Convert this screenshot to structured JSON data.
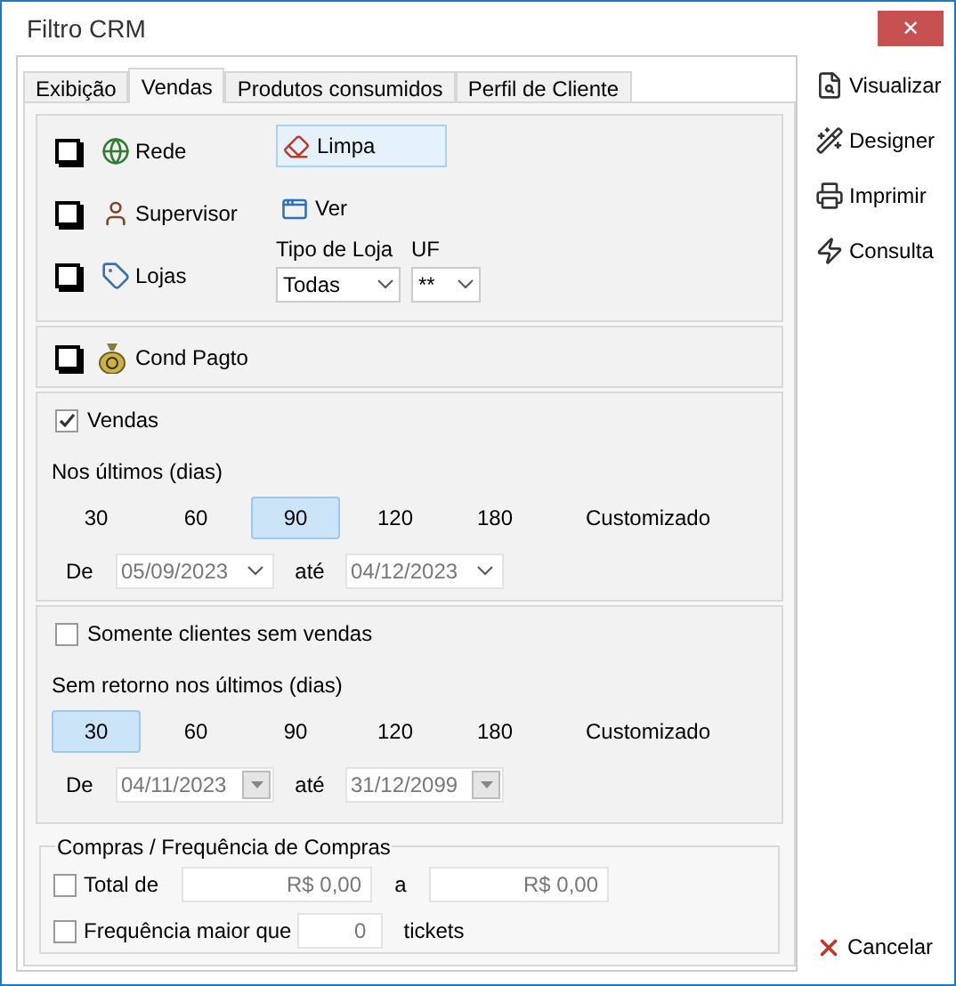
{
  "window": {
    "title": "Filtro CRM",
    "close": "✕"
  },
  "tabs": [
    {
      "label": "Exibição",
      "selected": false
    },
    {
      "label": "Vendas",
      "selected": true
    },
    {
      "label": "Produtos consumidos",
      "selected": false
    },
    {
      "label": "Perfil de Cliente",
      "selected": false
    }
  ],
  "filters": [
    {
      "label": "Rede",
      "checked": false
    },
    {
      "label": "Supervisor",
      "checked": false
    },
    {
      "label": "Lojas",
      "checked": false
    }
  ],
  "limpa_button": {
    "label": "Limpa"
  },
  "ver_button": {
    "label": "Ver"
  },
  "tipo_de_loja": {
    "label": "Tipo de Loja",
    "value": "Todas"
  },
  "uf": {
    "label": "UF",
    "value": "**"
  },
  "cond_pagto": {
    "label": "Cond Pagto",
    "checked": false
  },
  "sales_sections": [
    {
      "label": "Vendas",
      "checked": true,
      "subtitle": "Nos últimos (dias)",
      "periods": [
        {
          "label": "30",
          "selected": false
        },
        {
          "label": "60",
          "selected": false
        },
        {
          "label": "90",
          "selected": true
        },
        {
          "label": "120",
          "selected": false
        },
        {
          "label": "180",
          "selected": false
        },
        {
          "label": "Customizado",
          "selected": false
        }
      ],
      "de_label": "De",
      "de_value": "05/09/2023",
      "ate_label": "até",
      "ate_value": "04/12/2023",
      "kind": "chevron"
    },
    {
      "label": "Somente clientes sem vendas",
      "checked": false,
      "subtitle": "Sem retorno nos últimos (dias)",
      "periods": [
        {
          "label": "30",
          "selected": true
        },
        {
          "label": "60",
          "selected": false
        },
        {
          "label": "90",
          "selected": false
        },
        {
          "label": "120",
          "selected": false
        },
        {
          "label": "180",
          "selected": false
        },
        {
          "label": "Customizado",
          "selected": false
        }
      ],
      "de_label": "De",
      "de_value": "04/11/2023",
      "ate_label": "até",
      "ate_value": "31/12/2099",
      "kind": "button"
    }
  ],
  "compras": {
    "title": "Compras / Frequência de Compras",
    "total": {
      "label": "Total de",
      "checked": false,
      "from": "R$ 0,00",
      "to_label": "a",
      "to": "R$ 0,00"
    },
    "frequencia": {
      "label": "Frequência maior que",
      "checked": false,
      "value": "0",
      "unit": "tickets"
    }
  },
  "actions": [
    {
      "label": "Visualizar"
    },
    {
      "label": "Designer"
    },
    {
      "label": "Imprimir"
    },
    {
      "label": "Consulta"
    }
  ],
  "cancel": {
    "label": "Cancelar"
  }
}
